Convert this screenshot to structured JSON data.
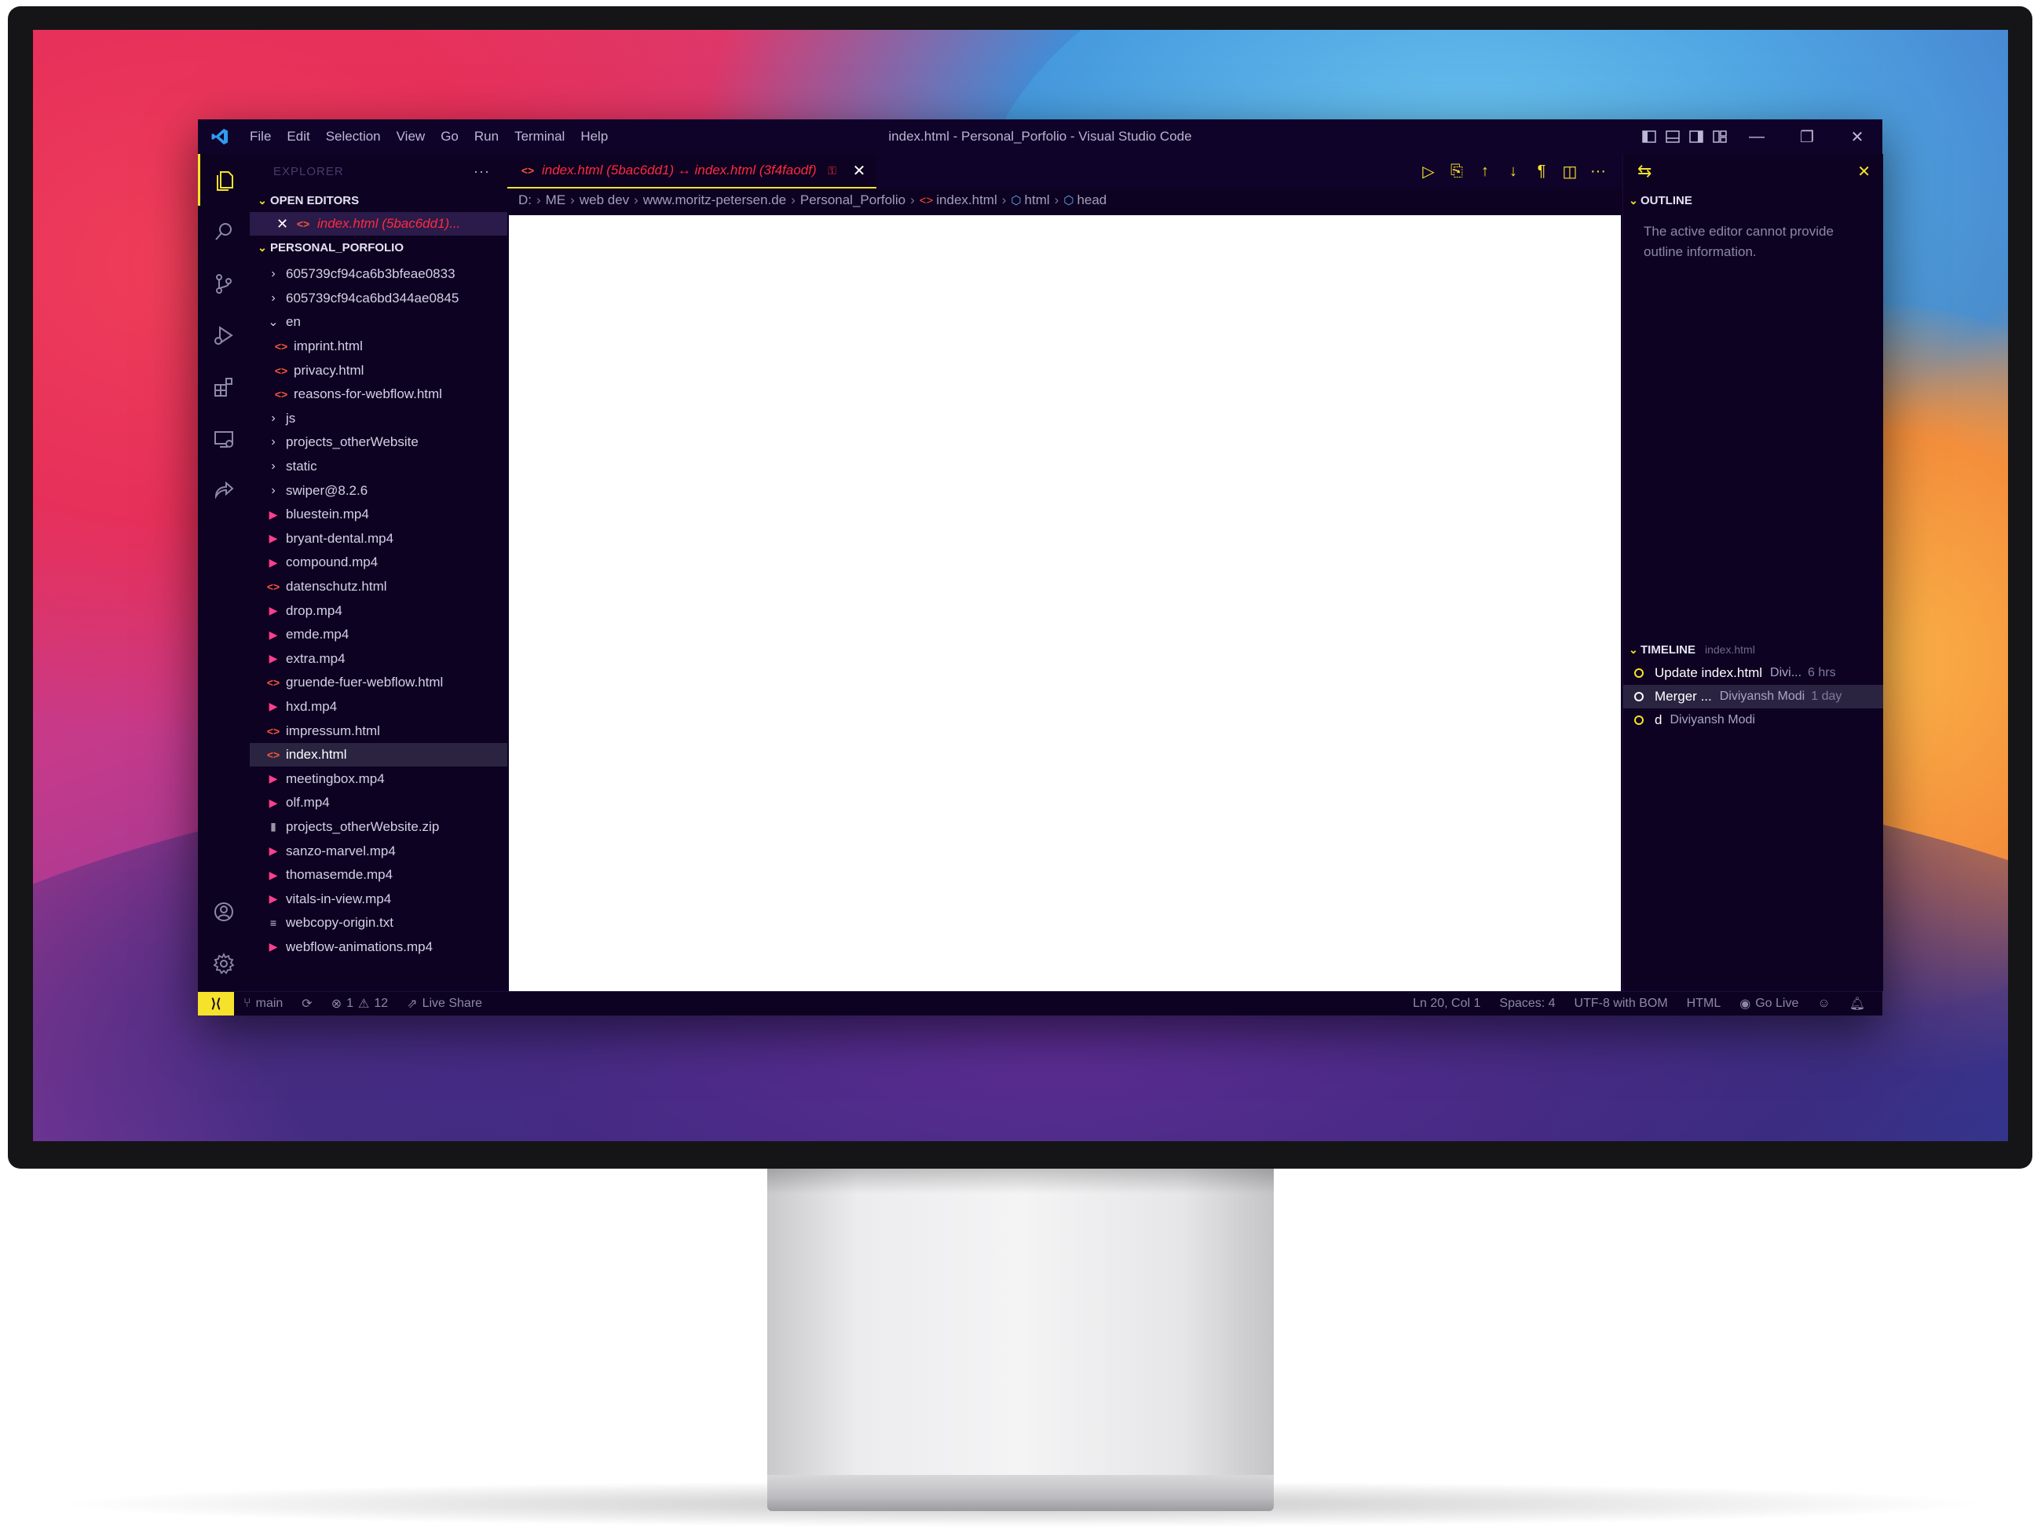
{
  "window": {
    "title": "index.html - Personal_Porfolio - Visual Studio Code",
    "menu": [
      "File",
      "Edit",
      "Selection",
      "View",
      "Go",
      "Run",
      "Terminal",
      "Help"
    ],
    "controls": {
      "minimize": "—",
      "restore": "❐",
      "close": "✕"
    }
  },
  "activity_bar": {
    "icons": [
      "explorer-icon",
      "search-icon",
      "source-control-icon",
      "run-debug-icon",
      "extensions-icon",
      "remote-explorer-icon",
      "live-share-icon",
      "account-icon",
      "settings-icon"
    ]
  },
  "sidebar": {
    "header": "EXPLORER",
    "more": "···",
    "open_editors_title": "OPEN EDITORS",
    "open_editor": {
      "label": "index.html (5bac6dd1)...",
      "close": "✕"
    },
    "project_title": "PERSONAL_PORFOLIO",
    "files": [
      {
        "name": "605739cf94ca6b3bfeae0833",
        "type": "folder",
        "indent": 0
      },
      {
        "name": "605739cf94ca6bd344ae0845",
        "type": "folder",
        "indent": 0
      },
      {
        "name": "en",
        "type": "folder-open",
        "indent": 0
      },
      {
        "name": "imprint.html",
        "type": "html",
        "indent": 1
      },
      {
        "name": "privacy.html",
        "type": "html",
        "indent": 1
      },
      {
        "name": "reasons-for-webflow.html",
        "type": "html",
        "indent": 1
      },
      {
        "name": "js",
        "type": "folder",
        "indent": 0
      },
      {
        "name": "projects_otherWebsite",
        "type": "folder",
        "indent": 0
      },
      {
        "name": "static",
        "type": "folder",
        "indent": 0
      },
      {
        "name": "swiper@8.2.6",
        "type": "folder",
        "indent": 0
      },
      {
        "name": "bluestein.mp4",
        "type": "mp4",
        "indent": 0
      },
      {
        "name": "bryant-dental.mp4",
        "type": "mp4",
        "indent": 0
      },
      {
        "name": "compound.mp4",
        "type": "mp4",
        "indent": 0
      },
      {
        "name": "datenschutz.html",
        "type": "html",
        "indent": 0
      },
      {
        "name": "drop.mp4",
        "type": "mp4",
        "indent": 0
      },
      {
        "name": "emde.mp4",
        "type": "mp4",
        "indent": 0
      },
      {
        "name": "extra.mp4",
        "type": "mp4",
        "indent": 0
      },
      {
        "name": "gruende-fuer-webflow.html",
        "type": "html",
        "indent": 0
      },
      {
        "name": "hxd.mp4",
        "type": "mp4",
        "indent": 0
      },
      {
        "name": "impressum.html",
        "type": "html",
        "indent": 0
      },
      {
        "name": "index.html",
        "type": "html",
        "indent": 0,
        "selected": true
      },
      {
        "name": "meetingbox.mp4",
        "type": "mp4",
        "indent": 0
      },
      {
        "name": "olf.mp4",
        "type": "mp4",
        "indent": 0
      },
      {
        "name": "projects_otherWebsite.zip",
        "type": "zip",
        "indent": 0
      },
      {
        "name": "sanzo-marvel.mp4",
        "type": "mp4",
        "indent": 0
      },
      {
        "name": "thomasemde.mp4",
        "type": "mp4",
        "indent": 0
      },
      {
        "name": "vitals-in-view.mp4",
        "type": "mp4",
        "indent": 0
      },
      {
        "name": "webcopy-origin.txt",
        "type": "txt",
        "indent": 0
      },
      {
        "name": "webflow-animations.mp4",
        "type": "mp4",
        "indent": 0
      }
    ]
  },
  "editor": {
    "tab": {
      "label": "index.html (5bac6dd1) ↔ index.html (3f4faodf)",
      "close": "✕"
    },
    "breadcrumbs": [
      "D:",
      "ME",
      "web dev",
      "www.moritz-petersen.de",
      "Personal_Porfolio",
      "index.html",
      "html",
      "head"
    ]
  },
  "right_panel": {
    "close": "✕",
    "outline_title": "OUTLINE",
    "outline_message": "The active editor cannot provide outline information.",
    "timeline_title": "TIMELINE",
    "timeline_file": "index.html",
    "timeline": [
      {
        "label": "Update index.html",
        "author": "Divi...",
        "time": "6 hrs",
        "selected": false
      },
      {
        "label": "Merger ...",
        "author": "Diviyansh Modi",
        "time": "1 day",
        "selected": true
      },
      {
        "label": "d",
        "author": "Diviyansh Modi",
        "time": "",
        "selected": false
      }
    ]
  },
  "statusbar": {
    "remote": "⟩⟨",
    "branch": "main",
    "errors": "1",
    "warnings": "12",
    "live_share": "Live Share",
    "position": "Ln 20, Col 1",
    "spaces": "Spaces: 4",
    "encoding": "UTF-8 with BOM",
    "language": "HTML",
    "go_live": "Go Live"
  },
  "colors": {
    "accent": "#f6e22b",
    "background": "#0d0221",
    "tab_text": "#ff2a3d",
    "html_icon": "#f6543a",
    "mp4_icon": "#ff3f8e"
  }
}
